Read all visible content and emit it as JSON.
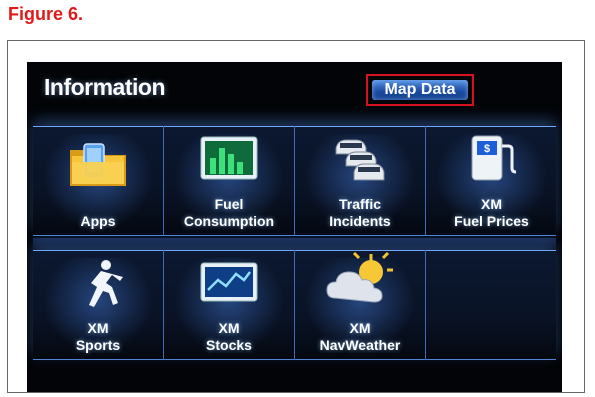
{
  "figure_caption": "Figure 6.",
  "screen": {
    "title": "Information",
    "map_data_button": "Map Data"
  },
  "tiles_top": [
    {
      "name": "apps",
      "line1": "",
      "line2": "Apps",
      "icon": "folder-icon"
    },
    {
      "name": "fuel-consumption",
      "line1": "Fuel",
      "line2": "Consumption",
      "icon": "bar-chart-icon"
    },
    {
      "name": "traffic-incidents",
      "line1": "Traffic",
      "line2": "Incidents",
      "icon": "traffic-cars-icon"
    },
    {
      "name": "xm-fuel-prices",
      "line1": "XM",
      "line2": "Fuel Prices",
      "icon": "fuel-pump-icon"
    }
  ],
  "tiles_bottom": [
    {
      "name": "xm-sports",
      "line1": "XM",
      "line2": "Sports",
      "icon": "runner-icon"
    },
    {
      "name": "xm-stocks",
      "line1": "XM",
      "line2": "Stocks",
      "icon": "stock-chart-icon"
    },
    {
      "name": "xm-navweather",
      "line1": "XM",
      "line2": "NavWeather",
      "icon": "weather-sun-cloud-icon"
    },
    {
      "name": "empty",
      "line1": "",
      "line2": "",
      "icon": ""
    }
  ],
  "colors": {
    "caption_red": "#e01a1a",
    "button_blue": "#1d4da5",
    "highlight_red": "#d8121f",
    "panel_edge": "#6fa7ff"
  }
}
